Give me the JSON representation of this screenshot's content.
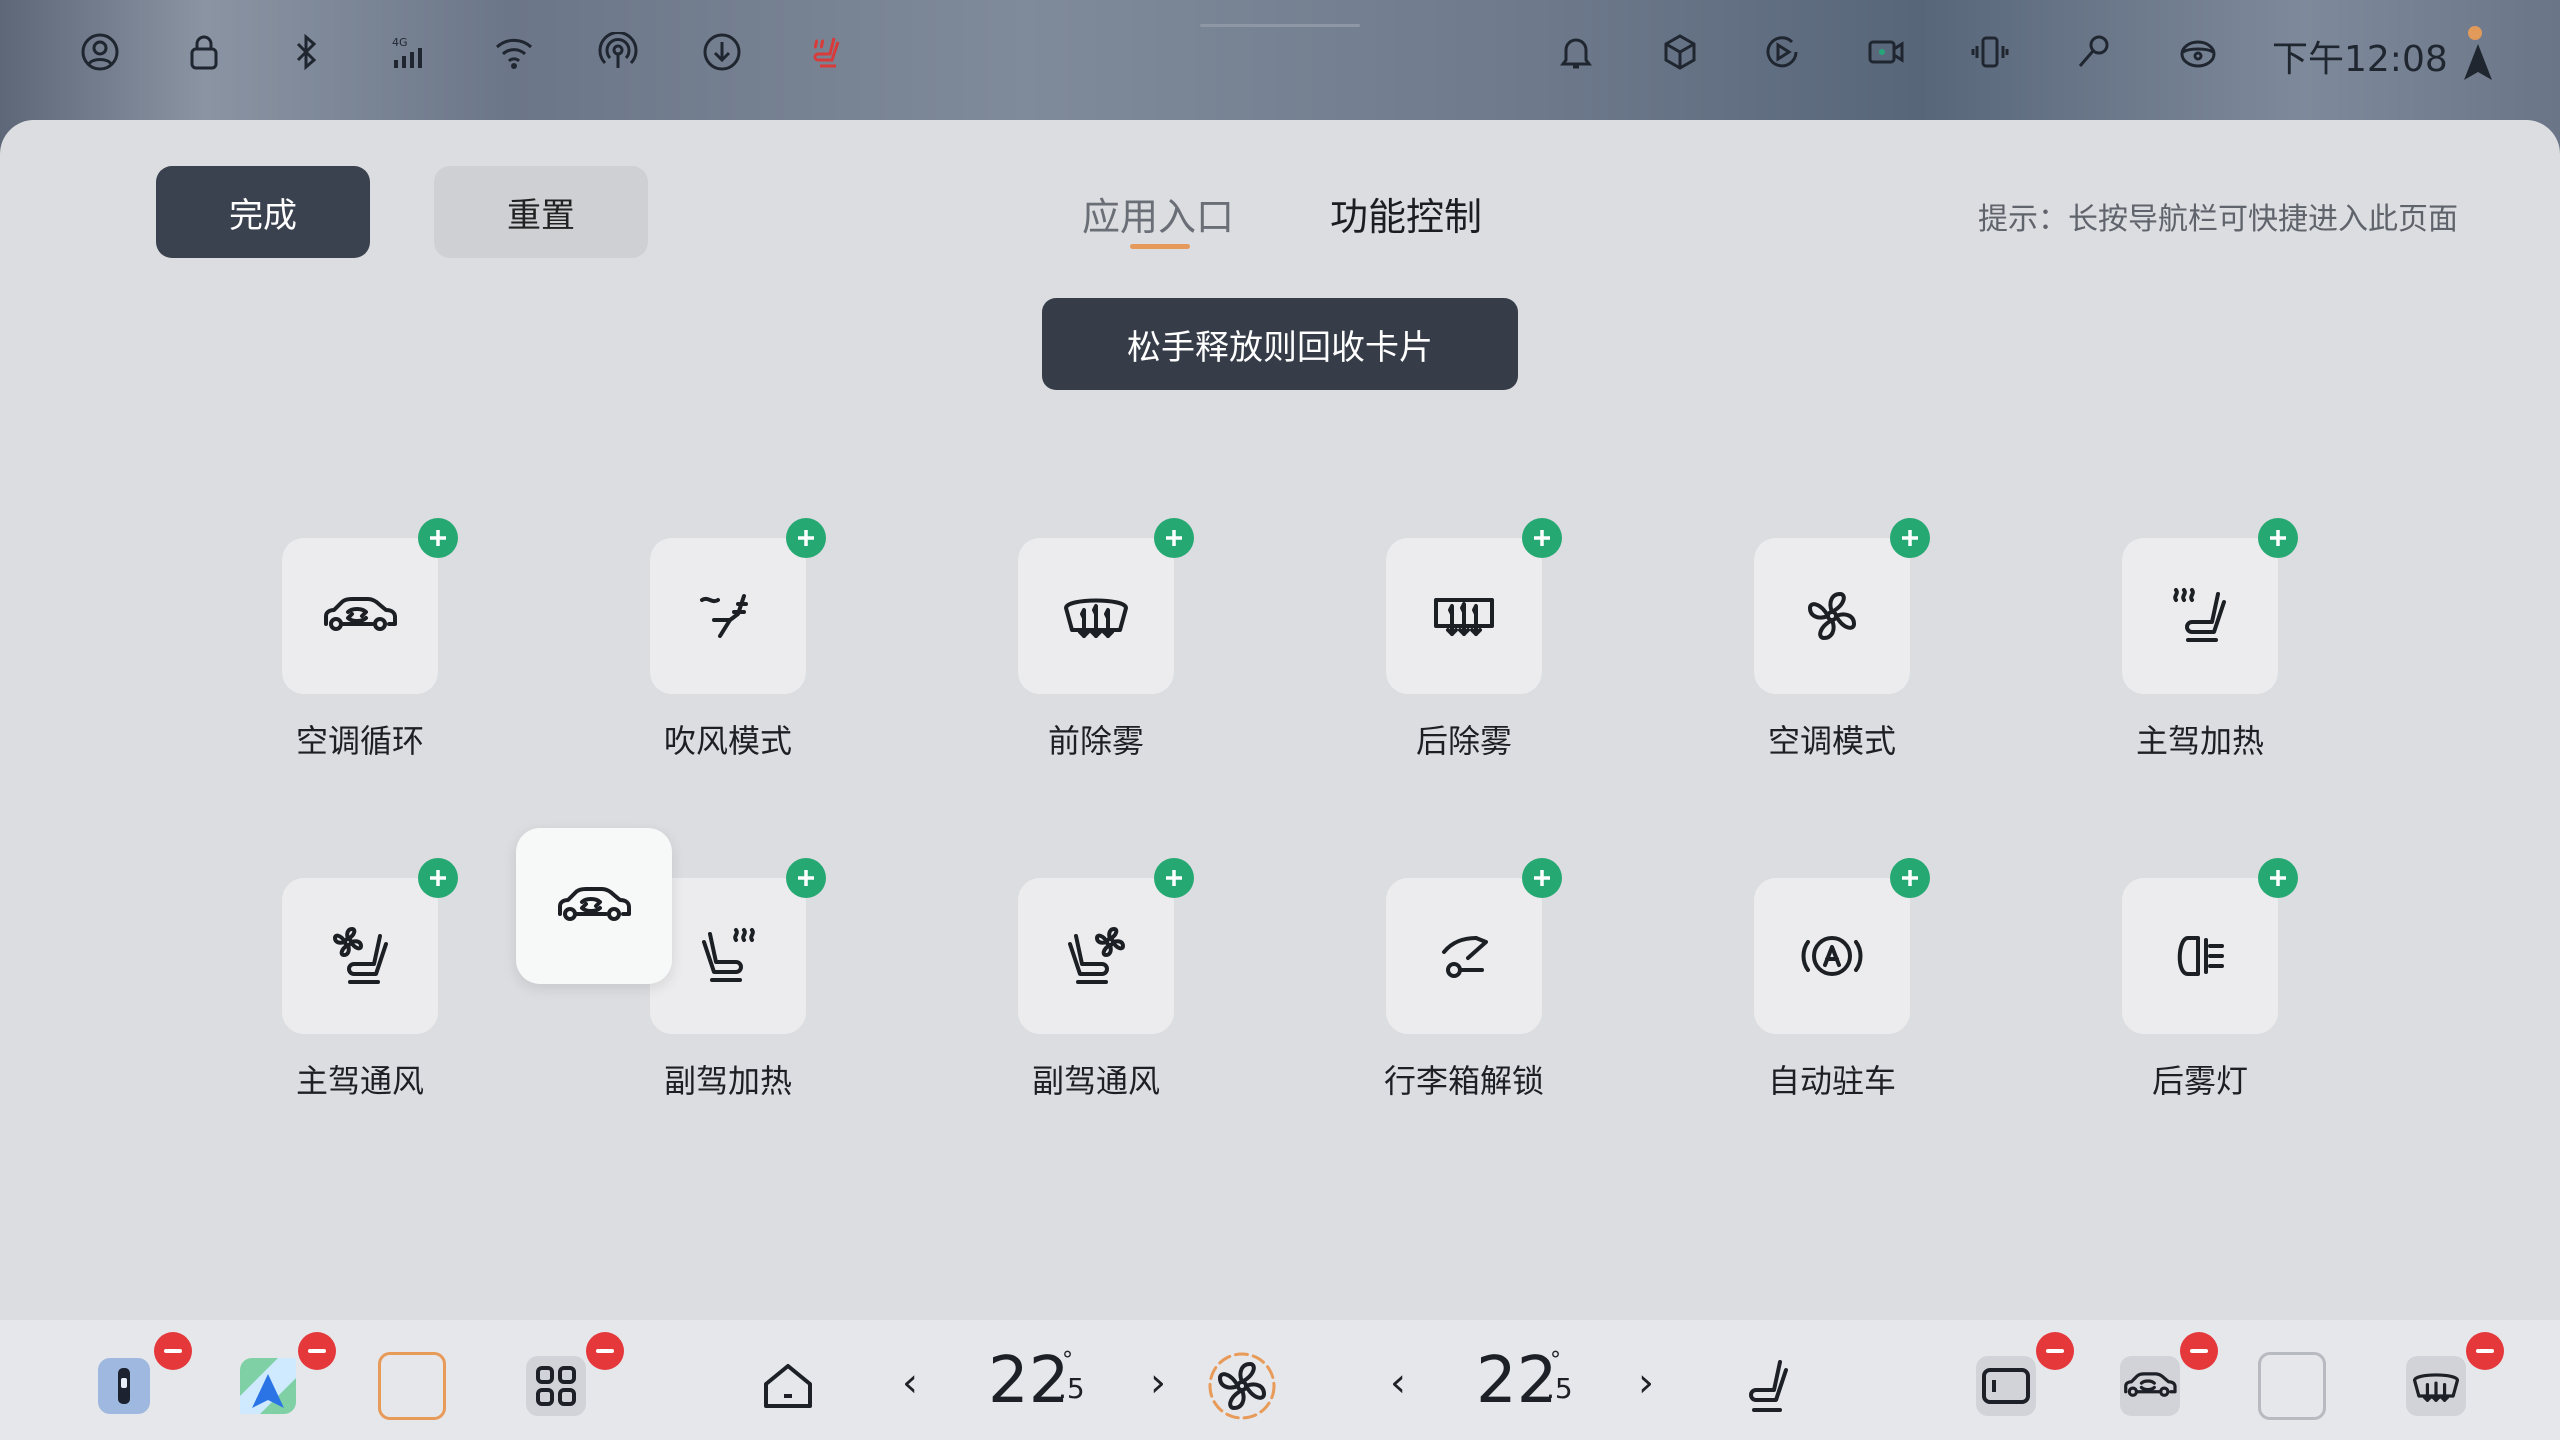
{
  "status_bar": {
    "time": "下午12:08",
    "network": "4G",
    "left_icons": [
      "user-icon",
      "lock-icon",
      "bluetooth-icon",
      "cellular-4g-icon",
      "wifi-icon",
      "hotspot-icon",
      "download-icon",
      "seat-heat-icon"
    ],
    "right_icons": [
      "bell-icon",
      "cube-icon",
      "play-circle-icon",
      "camera-icon",
      "phone-vibrate-icon",
      "microphone-icon",
      "steering-icon"
    ]
  },
  "header": {
    "done_label": "完成",
    "reset_label": "重置",
    "tabs": [
      {
        "label": "应用入口",
        "active": true
      },
      {
        "label": "功能控制",
        "active": false
      }
    ],
    "hint": "提示：长按导航栏可快捷进入此页面"
  },
  "toast": "松手释放则回收卡片",
  "tiles": [
    {
      "label": "空调循环",
      "icon": "ac-recirculation-icon"
    },
    {
      "label": "吹风模式",
      "icon": "airflow-mode-icon"
    },
    {
      "label": "前除雾",
      "icon": "front-defrost-icon"
    },
    {
      "label": "后除雾",
      "icon": "rear-defrost-icon"
    },
    {
      "label": "空调模式",
      "icon": "fan-icon"
    },
    {
      "label": "主驾加热",
      "icon": "driver-seat-heat-icon"
    },
    {
      "label": "主驾通风",
      "icon": "driver-seat-vent-icon"
    },
    {
      "label": "副驾加热",
      "icon": "passenger-seat-heat-icon"
    },
    {
      "label": "副驾通风",
      "icon": "passenger-seat-vent-icon"
    },
    {
      "label": "行李箱解锁",
      "icon": "trunk-unlock-icon"
    },
    {
      "label": "自动驻车",
      "icon": "auto-hold-icon"
    },
    {
      "label": "后雾灯",
      "icon": "rear-fog-light-icon"
    }
  ],
  "dragging_icon": "ac-recirculation-icon",
  "bottom_bar": {
    "left_temp": {
      "whole": "22",
      "decimal": ".5",
      "unit": "°"
    },
    "right_temp": {
      "whole": "22",
      "decimal": ".5",
      "unit": "°"
    },
    "prev_glyph": "‹",
    "next_glyph": "›",
    "accent": "#e5383b"
  }
}
